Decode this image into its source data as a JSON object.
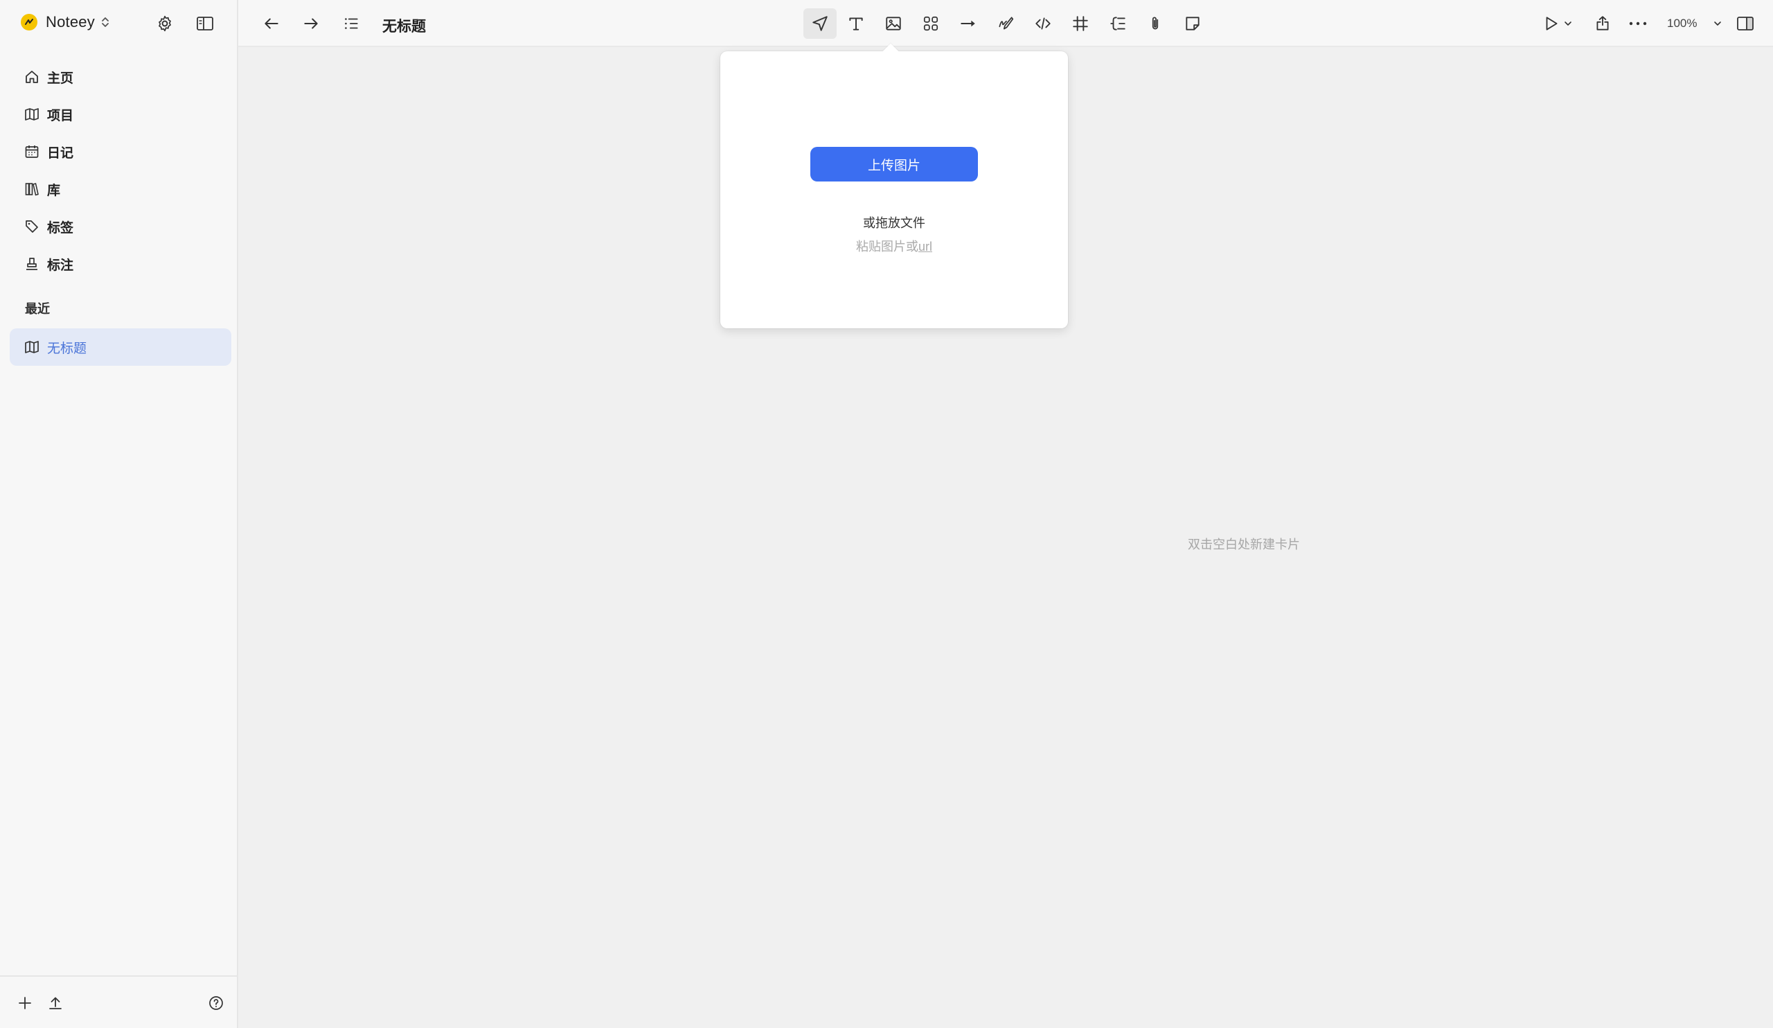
{
  "app": {
    "name": "Noteey",
    "brand_color": "#f5c400"
  },
  "sidebar": {
    "items": [
      {
        "label": "主页",
        "icon": "home-icon"
      },
      {
        "label": "项目",
        "icon": "map-icon"
      },
      {
        "label": "日记",
        "icon": "calendar-icon"
      },
      {
        "label": "库",
        "icon": "library-icon"
      },
      {
        "label": "标签",
        "icon": "tag-icon"
      },
      {
        "label": "标注",
        "icon": "highlighter-icon"
      }
    ],
    "recent_title": "最近",
    "recent": [
      {
        "label": "无标题",
        "icon": "map-icon"
      }
    ]
  },
  "topbar": {
    "doc_title": "无标题",
    "zoom": "100%"
  },
  "popover": {
    "upload_label": "上传图片",
    "drop_text": "或拖放文件",
    "paste_prefix": "粘贴图片或",
    "paste_url": "url"
  },
  "canvas": {
    "hint": "双击空白处新建卡片"
  },
  "colors": {
    "accent": "#3b6ef1",
    "active_item_bg": "#e3e9f7",
    "active_item_text": "#4a74d8"
  }
}
